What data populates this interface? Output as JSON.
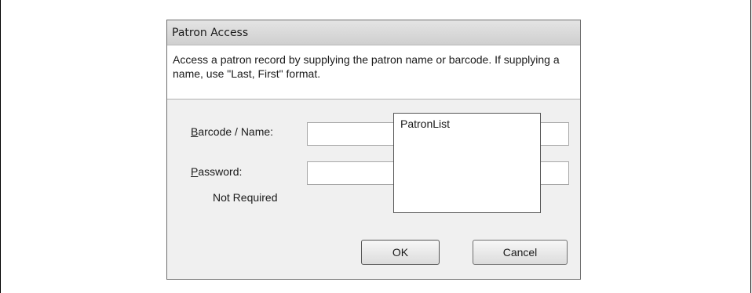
{
  "dialog": {
    "title": "Patron Access",
    "description": "Access a patron record by supplying the patron name or barcode. If supplying a name, use \"Last, First\" format."
  },
  "form": {
    "barcode_label_accel": "B",
    "barcode_label_rest": "arcode / Name:",
    "barcode_value": "",
    "password_label_accel": "P",
    "password_label_rest": "assword:",
    "password_value": "",
    "password_note": "Not Required"
  },
  "list": {
    "label": "PatronList"
  },
  "buttons": {
    "ok": "OK",
    "cancel": "Cancel"
  }
}
